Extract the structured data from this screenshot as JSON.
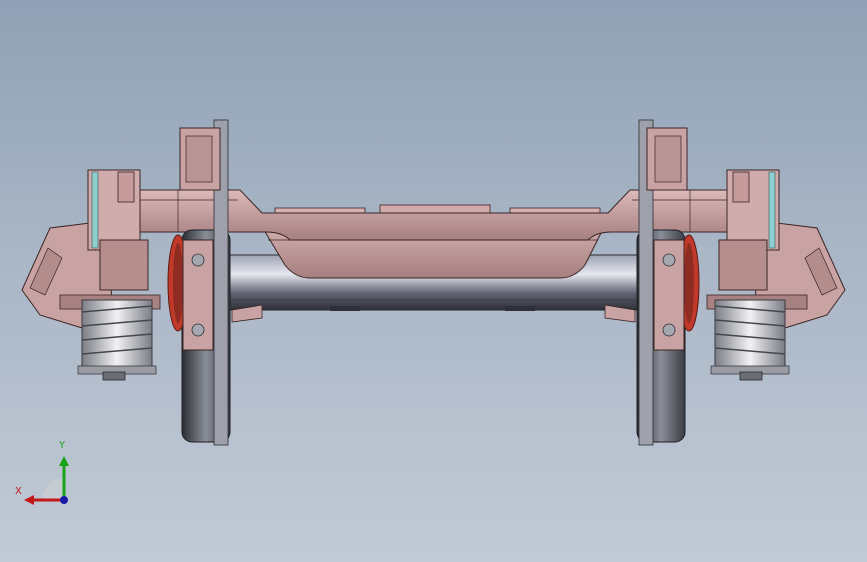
{
  "viewport": {
    "background_top": "#8fa1b5",
    "background_bottom": "#c2cad6"
  },
  "model": {
    "description_icon": "bogie-wheelset-icon",
    "colors": {
      "frame": "#c9a3a3",
      "frame_edge": "#3a2424",
      "axle": "#5f6270",
      "spring": "#c8c8cc",
      "wheel": "#55585f",
      "brake": "#c0392b"
    }
  },
  "triad": {
    "y_label": "Y",
    "x_label": "X",
    "y_color": "#19a319",
    "x_color": "#c41818",
    "origin_color": "#1a1aa8"
  }
}
